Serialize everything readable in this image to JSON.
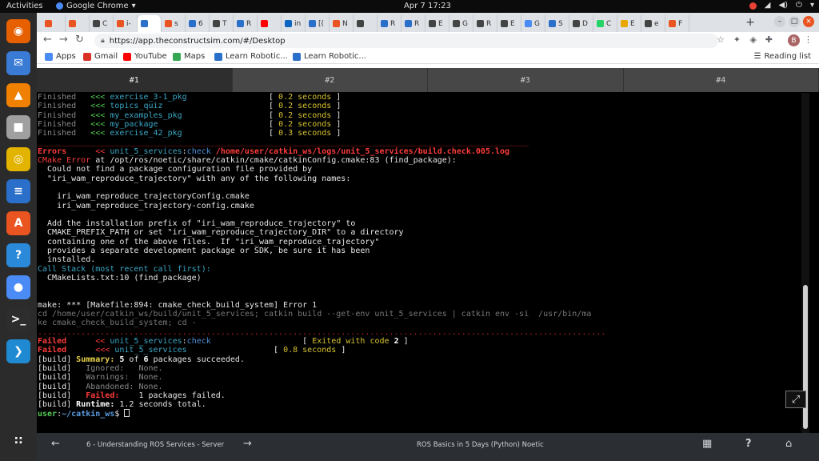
{
  "os_topbar": {
    "activities": "Activities",
    "app_name": "Google Chrome",
    "clock": "Apr 7  17:23"
  },
  "dock": {
    "items": [
      {
        "name": "firefox-icon",
        "glyph": "◉",
        "color": "#e66000"
      },
      {
        "name": "thunderbird-icon",
        "glyph": "✉",
        "color": "#3a7bd5"
      },
      {
        "name": "vlc-icon",
        "glyph": "▲",
        "color": "#f08000"
      },
      {
        "name": "files-icon",
        "glyph": "■",
        "color": "#a0a0a0"
      },
      {
        "name": "rhythmbox-icon",
        "glyph": "◎",
        "color": "#e2b400"
      },
      {
        "name": "writer-icon",
        "glyph": "≡",
        "color": "#2a6fc9"
      },
      {
        "name": "software-icon",
        "glyph": "A",
        "color": "#e95420"
      },
      {
        "name": "help-icon",
        "glyph": "?",
        "color": "#2a8ad9"
      },
      {
        "name": "chrome-icon",
        "glyph": "●",
        "color": "#4b8bf5"
      },
      {
        "name": "terminal-icon",
        "glyph": ">_",
        "color": "#2d2d2d"
      },
      {
        "name": "vscode-icon",
        "glyph": "❯",
        "color": "#1f8ad2"
      },
      {
        "name": "show-apps-icon",
        "glyph": "∷",
        "color": "#2b2b2b"
      }
    ]
  },
  "browser": {
    "tabs": [
      {
        "label": "",
        "color": "#e95420"
      },
      {
        "label": "",
        "color": "#e95420"
      },
      {
        "label": "C",
        "color": "#444"
      },
      {
        "label": "i-",
        "color": "#e95420"
      },
      {
        "label": "",
        "color": "#2a6fc9"
      },
      {
        "label": "s",
        "color": "#e95420"
      },
      {
        "label": "6",
        "color": "#2a6fc9"
      },
      {
        "label": "T",
        "color": "#444"
      },
      {
        "label": "R",
        "color": "#2a6fc9"
      },
      {
        "label": "",
        "color": "#ff0000"
      },
      {
        "label": "in",
        "color": "#0a66c2"
      },
      {
        "label": "[(",
        "color": "#2a6fc9"
      },
      {
        "label": "N",
        "color": "#e95420"
      },
      {
        "label": "",
        "color": "#444"
      },
      {
        "label": "R",
        "color": "#2a6fc9"
      },
      {
        "label": "R",
        "color": "#2a6fc9"
      },
      {
        "label": "E",
        "color": "#444"
      },
      {
        "label": "G",
        "color": "#444"
      },
      {
        "label": "R",
        "color": "#444"
      },
      {
        "label": "E",
        "color": "#444"
      },
      {
        "label": "G",
        "color": "#4b8bf5"
      },
      {
        "label": "S",
        "color": "#2a6fc9"
      },
      {
        "label": "D",
        "color": "#444"
      },
      {
        "label": "C",
        "color": "#25d366"
      },
      {
        "label": "E",
        "color": "#e9a800"
      },
      {
        "label": "e",
        "color": "#444"
      },
      {
        "label": "F",
        "color": "#e95420"
      }
    ],
    "url": "https://app.theconstructsim.com/#/Desktop",
    "bookmarks": [
      {
        "label": "Apps",
        "color": "#4b8bf5"
      },
      {
        "label": "Gmail",
        "color": "#d93025"
      },
      {
        "label": "YouTube",
        "color": "#ff0000"
      },
      {
        "label": "Maps",
        "color": "#34a853"
      },
      {
        "label": "Learn Robotic...",
        "color": "#2a6fc9"
      },
      {
        "label": "Learn Robotic...",
        "color": "#2a6fc9"
      }
    ],
    "reading_list": "Reading list",
    "avatar_letter": "B"
  },
  "webapp": {
    "terminal_tabs": [
      "#1",
      "#2",
      "#3",
      "#4"
    ],
    "active_tab": 0,
    "terminal_lines": [
      [
        {
          "t": "Finished  ",
          "c": "c-grey"
        },
        {
          "t": " <<< ",
          "c": "c-green"
        },
        {
          "t": "exercise_3-1_pkg",
          "c": "c-cyan"
        },
        {
          "t": "                 [ ",
          "c": ""
        },
        {
          "t": "0.2 seconds",
          "c": "c-yellow"
        },
        {
          "t": " ]",
          "c": ""
        }
      ],
      [
        {
          "t": "Finished  ",
          "c": "c-grey"
        },
        {
          "t": " <<< ",
          "c": "c-green"
        },
        {
          "t": "topics_quiz",
          "c": "c-cyan"
        },
        {
          "t": "                      [ ",
          "c": ""
        },
        {
          "t": "0.2 seconds",
          "c": "c-yellow"
        },
        {
          "t": " ]",
          "c": ""
        }
      ],
      [
        {
          "t": "Finished  ",
          "c": "c-grey"
        },
        {
          "t": " <<< ",
          "c": "c-green"
        },
        {
          "t": "my_examples_pkg",
          "c": "c-cyan"
        },
        {
          "t": "                  [ ",
          "c": ""
        },
        {
          "t": "0.2 seconds",
          "c": "c-yellow"
        },
        {
          "t": " ]",
          "c": ""
        }
      ],
      [
        {
          "t": "Finished  ",
          "c": "c-grey"
        },
        {
          "t": " <<< ",
          "c": "c-green"
        },
        {
          "t": "my_package",
          "c": "c-cyan"
        },
        {
          "t": "                       [ ",
          "c": ""
        },
        {
          "t": "0.2 seconds",
          "c": "c-yellow"
        },
        {
          "t": " ]",
          "c": ""
        }
      ],
      [
        {
          "t": "Finished  ",
          "c": "c-grey"
        },
        {
          "t": " <<< ",
          "c": "c-green"
        },
        {
          "t": "exercise_42_pkg",
          "c": "c-cyan"
        },
        {
          "t": "                  [ ",
          "c": ""
        },
        {
          "t": "0.3 seconds",
          "c": "c-yellow"
        },
        {
          "t": " ]",
          "c": ""
        }
      ],
      [
        {
          "t": "______________________________________________________________________________________________________",
          "c": "sep-line"
        }
      ],
      [
        {
          "t": "Errors     ",
          "c": "c-red"
        },
        {
          "t": " << ",
          "c": "c-redp"
        },
        {
          "t": "unit_5_services",
          "c": "c-cyan"
        },
        {
          "t": ":",
          "c": ""
        },
        {
          "t": "check",
          "c": "c-blue"
        },
        {
          "t": " /home/user/catkin_ws/logs/unit_5_services/build.check.005.log",
          "c": "c-red"
        }
      ],
      [
        {
          "t": "CMake Error",
          "c": "c-redp"
        },
        {
          "t": " at /opt/ros/noetic/share/catkin/cmake/catkinConfig.cmake:83 (find_package):",
          "c": ""
        }
      ],
      [
        {
          "t": "  Could not find a package configuration file provided by",
          "c": ""
        }
      ],
      [
        {
          "t": "  \"iri_wam_reproduce_trajectory\" with any of the following names:",
          "c": ""
        }
      ],
      [
        {
          "t": "",
          "c": ""
        }
      ],
      [
        {
          "t": "    iri_wam_reproduce_trajectoryConfig.cmake",
          "c": ""
        }
      ],
      [
        {
          "t": "    iri_wam_reproduce_trajectory-config.cmake",
          "c": ""
        }
      ],
      [
        {
          "t": "",
          "c": ""
        }
      ],
      [
        {
          "t": "  Add the installation prefix of \"iri_wam_reproduce_trajectory\" to",
          "c": ""
        }
      ],
      [
        {
          "t": "  CMAKE_PREFIX_PATH or set \"iri_wam_reproduce_trajectory_DIR\" to a directory",
          "c": ""
        }
      ],
      [
        {
          "t": "  containing one of the above files.  If \"iri_wam_reproduce_trajectory\"",
          "c": ""
        }
      ],
      [
        {
          "t": "  provides a separate development package or SDK, be sure it has been",
          "c": ""
        }
      ],
      [
        {
          "t": "  installed.",
          "c": ""
        }
      ],
      [
        {
          "t": "Call Stack (most recent call first):",
          "c": "c-cyan"
        }
      ],
      [
        {
          "t": "  CMakeLists.txt:10 (find_package)",
          "c": ""
        }
      ],
      [
        {
          "t": "",
          "c": ""
        }
      ],
      [
        {
          "t": "",
          "c": ""
        }
      ],
      [
        {
          "t": "make: *** [Makefile:894: cmake_check_build_system] Error 1",
          "c": ""
        }
      ],
      [
        {
          "t": "cd /home/user/catkin_ws/build/unit_5_services; catkin build --get-env unit_5_services | catkin env -si  /usr/bin/ma",
          "c": "c-dim"
        }
      ],
      [
        {
          "t": "ke cmake_check_build_system; cd -",
          "c": "c-dim"
        }
      ],
      [
        {
          "t": "......................................................................................................................",
          "c": "sep-line"
        }
      ],
      [
        {
          "t": "Failed     ",
          "c": "c-red"
        },
        {
          "t": " << ",
          "c": "c-redp"
        },
        {
          "t": "unit_5_services",
          "c": "c-cyan"
        },
        {
          "t": ":",
          "c": ""
        },
        {
          "t": "check",
          "c": "c-blue"
        },
        {
          "t": "                   [ ",
          "c": ""
        },
        {
          "t": "Exited with code ",
          "c": "c-yellow"
        },
        {
          "t": "2",
          "c": "c-white"
        },
        {
          "t": " ]",
          "c": ""
        }
      ],
      [
        {
          "t": "Failed     ",
          "c": "c-red"
        },
        {
          "t": " <<< ",
          "c": "c-redp"
        },
        {
          "t": "unit_5_services",
          "c": "c-cyan"
        },
        {
          "t": "                  [ ",
          "c": ""
        },
        {
          "t": "0.8 seconds",
          "c": "c-yellow"
        },
        {
          "t": " ]",
          "c": ""
        }
      ],
      [
        {
          "t": "[build] ",
          "c": ""
        },
        {
          "t": "Summary:",
          "c": "c-yb"
        },
        {
          "t": " ",
          "c": ""
        },
        {
          "t": "5",
          "c": "c-white"
        },
        {
          "t": " of ",
          "c": ""
        },
        {
          "t": "6",
          "c": "c-white"
        },
        {
          "t": " packages succeeded.",
          "c": ""
        }
      ],
      [
        {
          "t": "[build]   ",
          "c": ""
        },
        {
          "t": "Ignored:   None.",
          "c": "c-grey"
        }
      ],
      [
        {
          "t": "[build]   ",
          "c": ""
        },
        {
          "t": "Warnings:  None.",
          "c": "c-grey"
        }
      ],
      [
        {
          "t": "[build]   ",
          "c": ""
        },
        {
          "t": "Abandoned: None.",
          "c": "c-grey"
        }
      ],
      [
        {
          "t": "[build]   ",
          "c": ""
        },
        {
          "t": "Failed:",
          "c": "c-red"
        },
        {
          "t": "    1 packages failed.",
          "c": ""
        }
      ],
      [
        {
          "t": "[build] ",
          "c": ""
        },
        {
          "t": "Runtime:",
          "c": "c-white"
        },
        {
          "t": " 1.2 seconds total.",
          "c": ""
        }
      ],
      [
        {
          "t": "user",
          "c": "c-user"
        },
        {
          "t": ":",
          "c": ""
        },
        {
          "t": "~/catkin_ws",
          "c": "c-path"
        },
        {
          "t": "$ ",
          "c": ""
        }
      ]
    ],
    "bottom_bar": {
      "unit_title": "6 - Understanding ROS Services - Server",
      "course_title": "ROS Basics in 5 Days (Python) Noetic"
    }
  }
}
